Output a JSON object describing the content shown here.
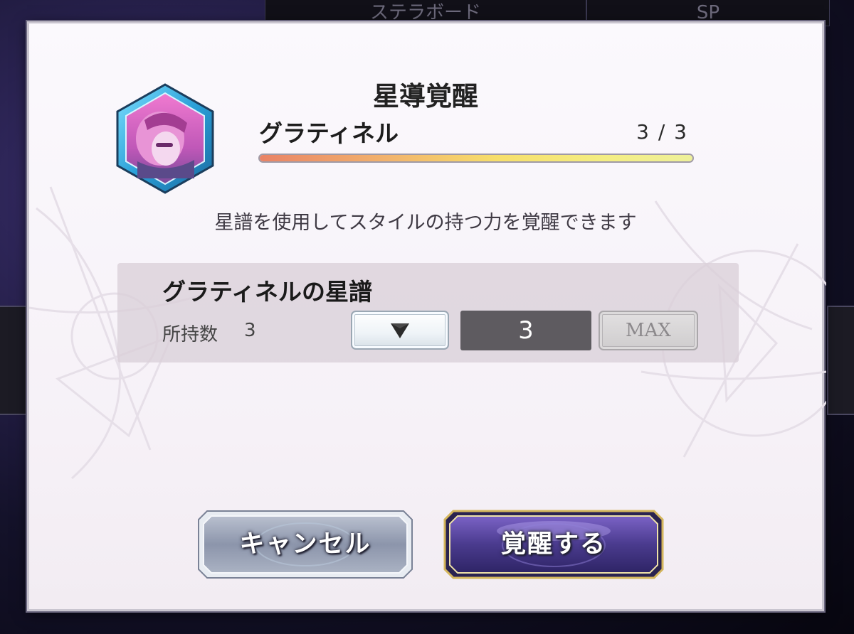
{
  "background": {
    "tab_left_label": "ステラボード",
    "tab_right_label": "SP"
  },
  "dialog": {
    "title": "星導覚醒",
    "character": {
      "name": "グラティネル",
      "count_label": "3 / 3",
      "progress_fraction": 1.0
    },
    "description": "星譜を使用してスタイルの持つ力を覚醒できます",
    "panel": {
      "title": "グラティネルの星譜",
      "owned_label": "所持数",
      "owned_value": "3",
      "quantity": "3",
      "max_label": "MAX"
    },
    "buttons": {
      "cancel_label": "キャンセル",
      "confirm_label": "覚醒する"
    }
  },
  "colors": {
    "confirm_border": "#d4b65c",
    "confirm_fill": "#4a3b8e",
    "cancel_fill": "#8a93a8",
    "progress_start": "#e98366",
    "progress_end": "#eef09a"
  },
  "icons": {
    "decrease": "down-triangle-icon",
    "portrait": "character-portrait-icon"
  }
}
